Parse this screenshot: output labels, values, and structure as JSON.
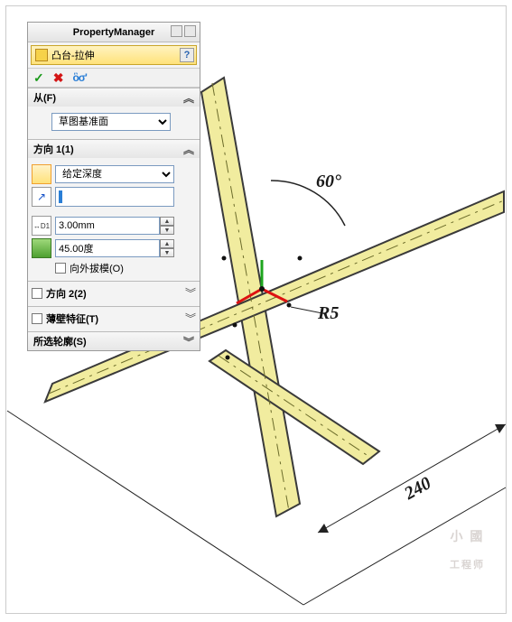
{
  "pm": {
    "title": "PropertyManager"
  },
  "feature": {
    "name": "凸台-拉伸",
    "help": "?"
  },
  "actions": {
    "ok": "✓",
    "cancel": "✖",
    "preview": "ὃσ'"
  },
  "from": {
    "title": "从(F)",
    "select_value": "草图基准面"
  },
  "dir1": {
    "title": "方向 1(1)",
    "end_condition": "给定深度",
    "depth": "3.00mm",
    "draft": "45.00度",
    "draft_outward_label": "向外拔模(O)"
  },
  "dir2": {
    "title": "方向 2(2)"
  },
  "thin": {
    "title": "薄壁特征(T)"
  },
  "contours": {
    "title": "所选轮廓(S)"
  },
  "dims": {
    "angle": "60°",
    "radius": "R5",
    "length": "240"
  },
  "watermark": {
    "small": "小 國",
    "big": "工程师"
  }
}
